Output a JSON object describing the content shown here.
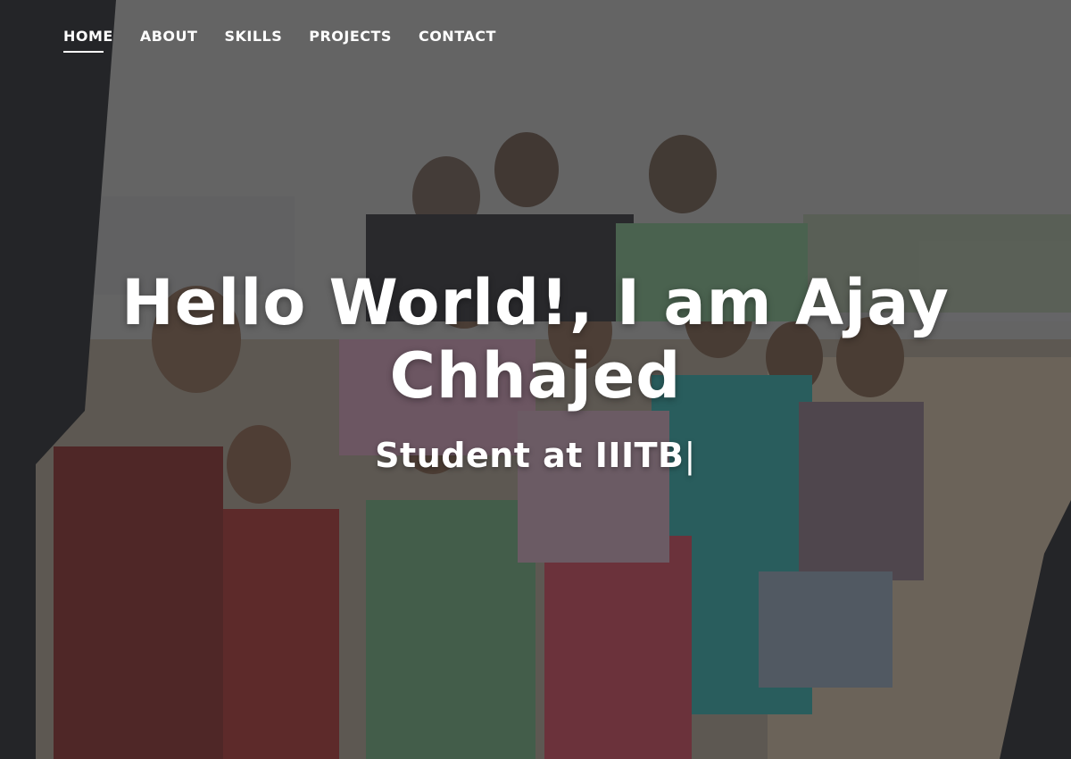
{
  "nav": {
    "items": [
      {
        "label": "HOME",
        "active": true
      },
      {
        "label": "ABOUT",
        "active": false
      },
      {
        "label": "SKILLS",
        "active": false
      },
      {
        "label": "PROJECTS",
        "active": false
      },
      {
        "label": "CONTACT",
        "active": false
      }
    ]
  },
  "hero": {
    "title": "Hello World!, I am Ajay Chhajed",
    "subtitle": "Student at IIITB",
    "cursor": "|",
    "background_image": "group-photo-children-and-volunteers-outdoors",
    "overlay_color": "#6b6b6b"
  },
  "colors": {
    "text": "#ffffff",
    "overlay": "#6b6b6b"
  }
}
